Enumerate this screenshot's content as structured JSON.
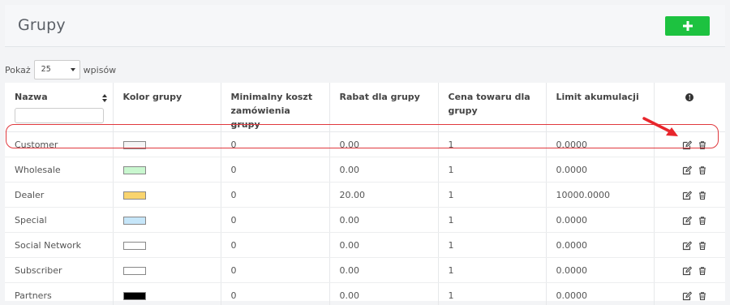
{
  "header": {
    "title": "Grupy",
    "add_label": "+"
  },
  "length": {
    "prefix": "Pokaż",
    "value": "25",
    "suffix": "wpisów"
  },
  "colors": {
    "accent_green": "#1dc240",
    "highlight_red": "#e0393e"
  },
  "table": {
    "headers": {
      "name": "Nazwa",
      "color": "Kolor grupy",
      "min_cost": "Minimalny koszt zamówienia grupy",
      "discount": "Rabat dla grupy",
      "price": "Cena towaru dla grupy",
      "limit": "Limit akumulacji",
      "info": "!"
    },
    "rows": [
      {
        "name": "Customer",
        "swatch": "#f5f5f5",
        "min_cost": "0",
        "discount": "0.00",
        "price": "1",
        "limit": "0.0000"
      },
      {
        "name": "Wholesale",
        "swatch": "#c9f7cf",
        "min_cost": "0",
        "discount": "0.00",
        "price": "1",
        "limit": "0.0000"
      },
      {
        "name": "Dealer",
        "swatch": "#f9d46e",
        "min_cost": "0",
        "discount": "20.00",
        "price": "1",
        "limit": "10000.0000"
      },
      {
        "name": "Special",
        "swatch": "#c6e6f9",
        "min_cost": "0",
        "discount": "0.00",
        "price": "1",
        "limit": "0.0000"
      },
      {
        "name": "Social Network",
        "swatch": "#ffffff",
        "min_cost": "0",
        "discount": "0.00",
        "price": "1",
        "limit": "0.0000"
      },
      {
        "name": "Subscriber",
        "swatch": "#ffffff",
        "min_cost": "0",
        "discount": "0.00",
        "price": "1",
        "limit": "0.0000"
      },
      {
        "name": "Partners",
        "swatch": "#000000",
        "min_cost": "0",
        "discount": "0.00",
        "price": "1",
        "limit": "0.0000"
      }
    ]
  }
}
